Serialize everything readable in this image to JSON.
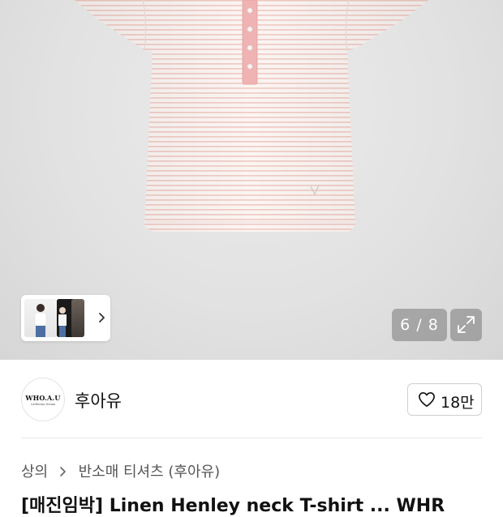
{
  "product_gallery": {
    "counter": "6 / 8",
    "image_alt": "product-photo",
    "colors": {
      "stripe": "#f0c9c4",
      "placket": "#efb3b3",
      "fabric": "#fbf5f2"
    }
  },
  "brand": {
    "logo_text": "WHO.A.U",
    "logo_subtext": "California Dream",
    "name": "후아유",
    "like_count": "18만"
  },
  "breadcrumb": {
    "items": [
      "상의",
      "반소매 티셔츠 (후아유)"
    ]
  },
  "product": {
    "title_partial": "[매진임박] Linen Henley neck T-shirt ... WHR"
  }
}
